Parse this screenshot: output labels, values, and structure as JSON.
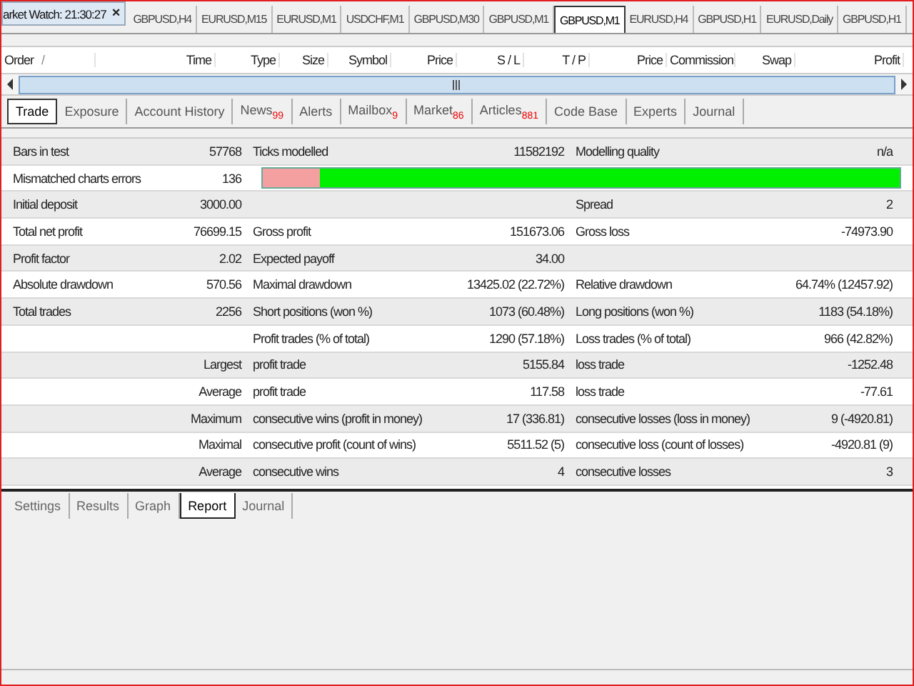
{
  "market_watch": {
    "title": "arket Watch: 21:30:27",
    "close": "×"
  },
  "chart_tabs": [
    {
      "label": "GBPUSD,H4",
      "selected": false
    },
    {
      "label": "EURUSD,M15",
      "selected": false
    },
    {
      "label": "EURUSD,M1",
      "selected": false
    },
    {
      "label": "USDCHF,M1",
      "selected": false
    },
    {
      "label": "GBPUSD,M30",
      "selected": false
    },
    {
      "label": "GBPUSD,M1",
      "selected": false
    },
    {
      "label": "GBPUSD,M1",
      "selected": true
    },
    {
      "label": "EURUSD,H4",
      "selected": false
    },
    {
      "label": "GBPUSD,H1",
      "selected": false
    },
    {
      "label": "EURUSD,Daily",
      "selected": false
    },
    {
      "label": "GBPUSD,H1",
      "selected": false
    }
  ],
  "trade_table": {
    "columns": [
      {
        "label": "Order"
      },
      {
        "label": "/"
      },
      {
        "label": "Time"
      },
      {
        "label": "Type"
      },
      {
        "label": "Size"
      },
      {
        "label": "Symbol"
      },
      {
        "label": "Price"
      },
      {
        "label": "S / L"
      },
      {
        "label": "T / P"
      },
      {
        "label": "Price"
      },
      {
        "label": "Commission"
      },
      {
        "label": "Swap"
      },
      {
        "label": "Profit"
      }
    ]
  },
  "terminal_tabs": [
    {
      "label": "Trade",
      "selected": true
    },
    {
      "label": "Exposure",
      "selected": false
    },
    {
      "label": "Account History",
      "selected": false
    },
    {
      "label": "News",
      "badge": "99",
      "selected": false
    },
    {
      "label": "Alerts",
      "selected": false
    },
    {
      "label": "Mailbox",
      "badge": "9",
      "selected": false
    },
    {
      "label": "Market",
      "badge": "86",
      "selected": false
    },
    {
      "label": "Articles",
      "badge": "881",
      "selected": false
    },
    {
      "label": "Code Base",
      "selected": false
    },
    {
      "label": "Experts",
      "selected": false
    },
    {
      "label": "Journal",
      "selected": false
    }
  ],
  "report": {
    "rows": [
      {
        "kind": "text",
        "column_1": "Bars in test",
        "column_2": "57768",
        "column_3": "Ticks modelled",
        "column_4": "11582192",
        "column_5": "Modelling quality",
        "column_6": "n/a"
      },
      {
        "kind": "quality",
        "column_1": "Mismatched charts errors",
        "column_2": "136",
        "level": 0.09
      },
      {
        "kind": "text",
        "column_1": "Initial deposit",
        "column_2": "3000.00",
        "column_5": "Spread",
        "column_6": "2"
      },
      {
        "kind": "text",
        "column_1": "Total net profit",
        "column_2": "76699.15",
        "column_3": "Gross profit",
        "column_4": "151673.06",
        "column_5": "Gross loss",
        "column_6": "-74973.90"
      },
      {
        "kind": "text",
        "column_1": "Profit factor",
        "column_2": "2.02",
        "column_3": "Expected payoff",
        "column_4": "34.00"
      },
      {
        "kind": "text",
        "column_1": "Absolute drawdown",
        "column_2": "570.56",
        "column_3": "Maximal drawdown",
        "column_4": "13425.02 (22.72%)",
        "column_5": "Relative drawdown",
        "column_6": "64.74% (12457.92)"
      },
      {
        "kind": "text",
        "column_1": "Total trades",
        "column_2": "2256",
        "column_3": "Short positions (won %)",
        "column_4": "1073 (60.48%)",
        "column_5": "Long positions (won %)",
        "column_6": "1183 (54.18%)"
      },
      {
        "kind": "text",
        "column_3": "Profit trades (% of total)",
        "column_4": "1290 (57.18%)",
        "column_5": "Loss trades (% of total)",
        "column_6": "966 (42.82%)"
      },
      {
        "kind": "text",
        "column_2": "Largest",
        "column_3": "profit trade",
        "column_4": "5155.84",
        "column_5": "loss trade",
        "column_6": "-1252.48"
      },
      {
        "kind": "text",
        "column_2": "Average",
        "column_3": "profit trade",
        "column_4": "117.58",
        "column_5": "loss trade",
        "column_6": "-77.61"
      },
      {
        "kind": "text",
        "column_2": "Maximum",
        "column_3": "consecutive wins (profit in money)",
        "column_4": "17 (336.81)",
        "column_5": "consecutive losses (loss in money)",
        "column_6": "9 (-4920.81)"
      },
      {
        "kind": "text",
        "column_2": "Maximal",
        "column_3": "consecutive profit (count of wins)",
        "column_4": "5511.52 (5)",
        "column_5": "consecutive loss (count of losses)",
        "column_6": "-4920.81 (9)"
      },
      {
        "kind": "text",
        "column_2": "Average",
        "column_3": "consecutive wins",
        "column_4": "4",
        "column_5": "consecutive losses",
        "column_6": "3"
      }
    ]
  },
  "tester_tabs": [
    {
      "label": "Settings",
      "selected": false
    },
    {
      "label": "Results",
      "selected": false
    },
    {
      "label": "Graph",
      "selected": false
    },
    {
      "label": "Report",
      "selected": true
    },
    {
      "label": "Journal",
      "selected": false
    }
  ]
}
